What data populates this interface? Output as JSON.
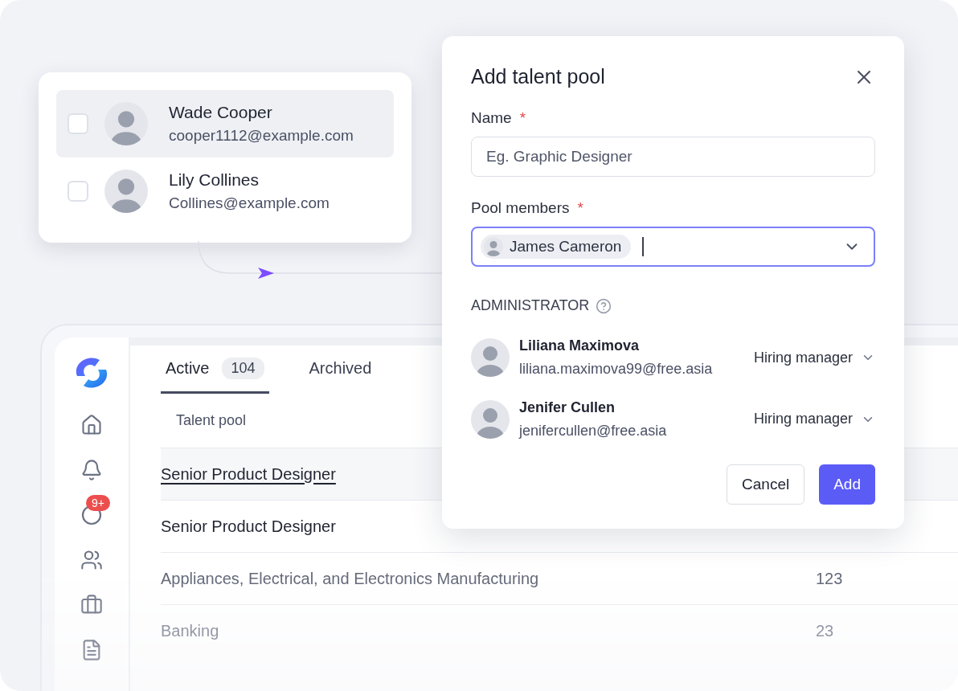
{
  "contact_card": {
    "contacts": [
      {
        "name": "Wade Cooper",
        "email": "cooper1112@example.com",
        "checked": false,
        "highlighted": true
      },
      {
        "name": "Lily Collines",
        "email": "Collines@example.com",
        "checked": false,
        "highlighted": false
      }
    ]
  },
  "app": {
    "sidebar": {
      "items": [
        {
          "kind": "home"
        },
        {
          "kind": "bell"
        },
        {
          "kind": "activity",
          "badge": "9+"
        },
        {
          "kind": "users"
        },
        {
          "kind": "briefcase"
        },
        {
          "kind": "file"
        }
      ]
    },
    "tabs": [
      {
        "label": "Active",
        "count": "104",
        "selected": true
      },
      {
        "label": "Archived",
        "selected": false
      }
    ],
    "table": {
      "columns": [
        "Talent pool"
      ],
      "rows": [
        {
          "name": "Senior Product Designer",
          "highlighted": true
        },
        {
          "name": "Senior Product Designer",
          "highlighted": false
        },
        {
          "name": "Appliances, Electrical, and Electronics Manufacturing",
          "count": "123",
          "highlighted": false
        },
        {
          "name": "Banking",
          "count": "23",
          "highlighted": false
        }
      ]
    }
  },
  "dialog": {
    "title": "Add talent pool",
    "fields": [
      {
        "kind": "text",
        "label": "Name",
        "required_mark": "*",
        "placeholder": "Eg. Graphic Designer",
        "focused": false
      },
      {
        "kind": "select",
        "label": "Pool members",
        "required_mark": "*",
        "chips": [
          "James Cameron"
        ],
        "focused": true
      }
    ],
    "admin_section": {
      "title": "ADMINISTRATOR",
      "admins": [
        {
          "name": "Liliana Maximova",
          "email": "liliana.maximova99@free.asia",
          "role": "Hiring manager"
        },
        {
          "name": "Jenifer Cullen",
          "email": "jenifercullen@free.asia",
          "role": "Hiring manager"
        }
      ]
    },
    "buttons": [
      {
        "label": "Cancel",
        "kind": "secondary"
      },
      {
        "label": "Add",
        "kind": "primary"
      }
    ]
  }
}
